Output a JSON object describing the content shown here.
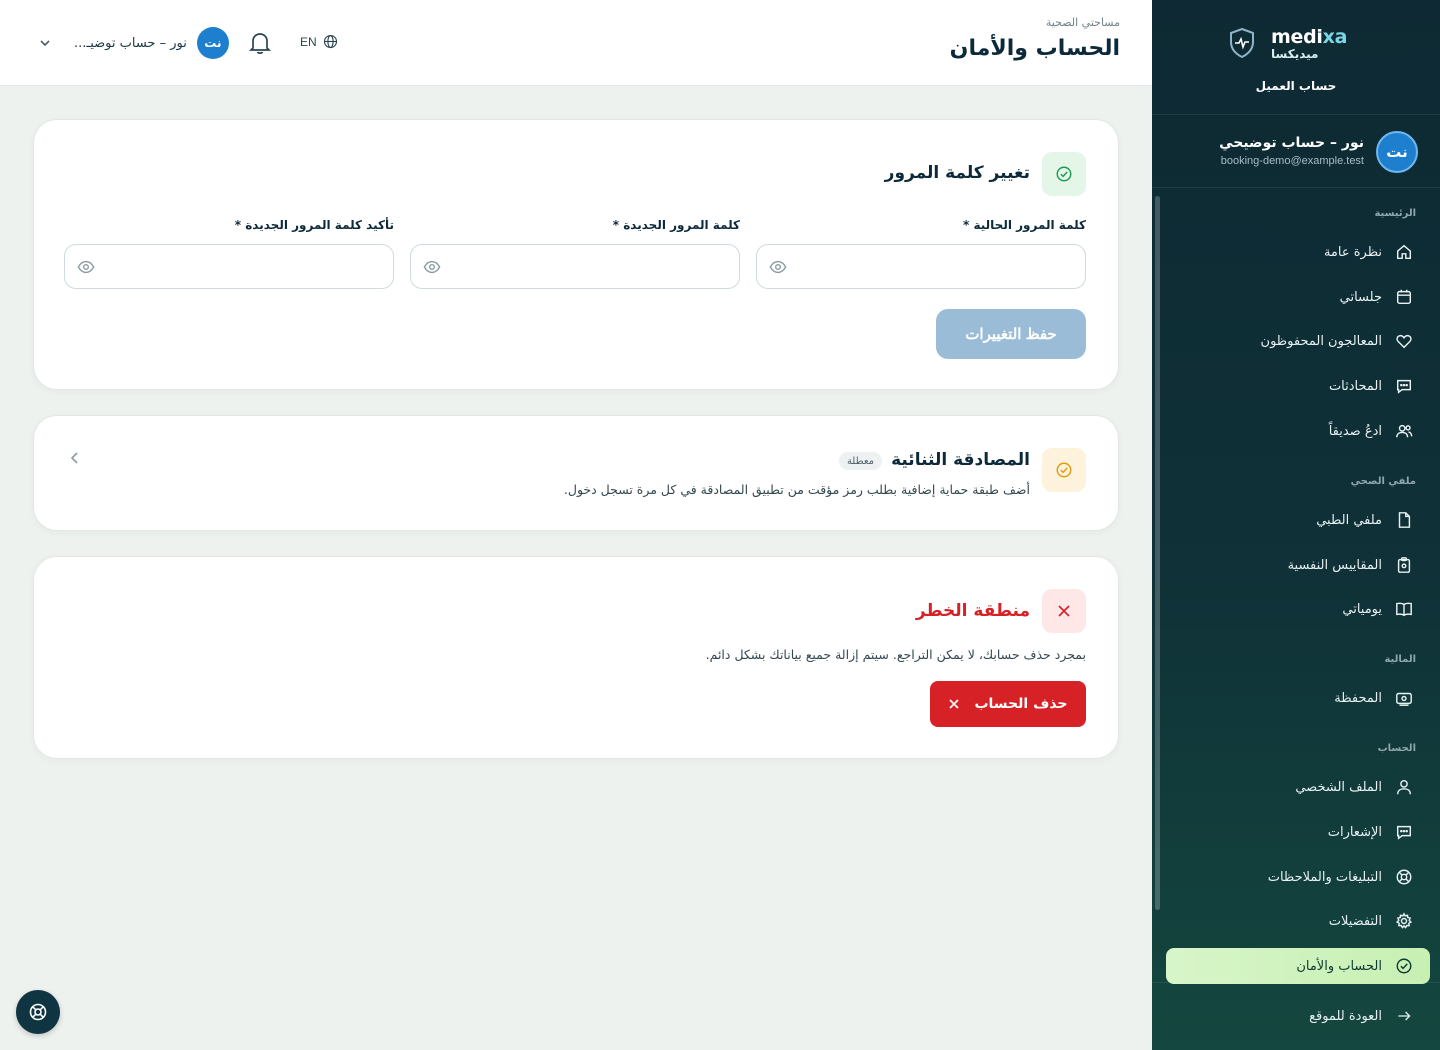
{
  "brand": {
    "name_left": "medi",
    "name_right": "xa",
    "arabic_name": "ميديكسا",
    "subtitle": "حساب العميل"
  },
  "sidebar_user": {
    "initials": "نت",
    "name": "نور – حساب توضيحي",
    "email": "booking-demo@example.test"
  },
  "sidebar": {
    "sections": [
      {
        "title": "الرئيسية"
      },
      {
        "title": "ملفي الصحي"
      },
      {
        "title": "المالية"
      },
      {
        "title": "الحساب"
      }
    ],
    "items": [
      {
        "label": "نظرة عامة",
        "icon": "home-icon"
      },
      {
        "label": "جلساتي",
        "icon": "calendar-icon"
      },
      {
        "label": "المعالجون المحفوظون",
        "icon": "heart-icon"
      },
      {
        "label": "المحادثات",
        "icon": "chat-icon"
      },
      {
        "label": "ادعُ صديقاً",
        "icon": "users-icon"
      },
      {
        "label": "ملفي الطبي",
        "icon": "file-icon"
      },
      {
        "label": "المقاييس النفسية",
        "icon": "clipboard-icon"
      },
      {
        "label": "يومياتي",
        "icon": "book-icon"
      },
      {
        "label": "المحفظة",
        "icon": "wallet-icon"
      },
      {
        "label": "الملف الشخصي",
        "icon": "user-icon"
      },
      {
        "label": "الإشعارات",
        "icon": "chat-icon"
      },
      {
        "label": "التبليغات والملاحظات",
        "icon": "lifebuoy-icon"
      },
      {
        "label": "التفضيلات",
        "icon": "gear-icon"
      },
      {
        "label": "الحساب والأمان",
        "icon": "check-circle-icon",
        "active": true
      }
    ],
    "back_label": "العودة للموقع"
  },
  "header": {
    "breadcrumb": "مساحتي الصحية",
    "title": "الحساب والأمان",
    "language": "EN",
    "user_initials": "نت",
    "user_name": "نور – حساب توضيـ..."
  },
  "password_card": {
    "title": "تغيير كلمة المرور",
    "fields": [
      {
        "label": "كلمة المرور الحالية",
        "required": "*",
        "value": ""
      },
      {
        "label": "كلمة المرور الجديدة",
        "required": "*",
        "value": ""
      },
      {
        "label": "تأكيد كلمة المرور الجديدة",
        "required": "*",
        "value": ""
      }
    ],
    "save_label": "حفظ التغييرات"
  },
  "twofa_card": {
    "title": "المصادقة الثنائية",
    "badge": "معطلة",
    "description": "أضف طبقة حماية إضافية بطلب رمز مؤقت من تطبيق المصادقة في كل مرة تسجل دخول."
  },
  "danger_card": {
    "title": "منطقة الخطر",
    "description": "بمجرد حذف حسابك، لا يمكن التراجع. سيتم إزالة جميع بياناتك بشكل دائم.",
    "delete_label": "حذف الحساب"
  },
  "colors": {
    "sidebar_bg": "#0e2933",
    "accent_blue": "#1f7fcf",
    "active_item": "#d7f5c9",
    "danger": "#d62227",
    "save_disabled": "#9bbcd6"
  }
}
